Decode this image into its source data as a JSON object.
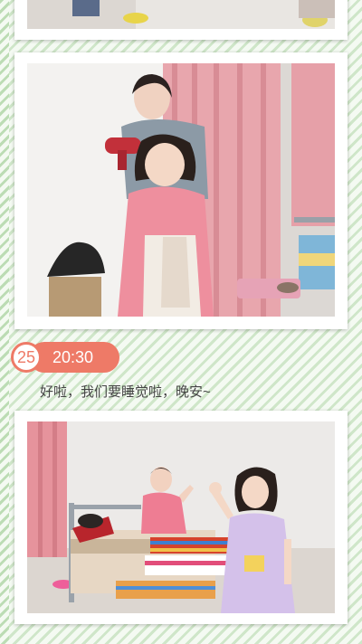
{
  "entry": {
    "day_number": "25",
    "time": "20:30",
    "caption": "好啦，我们要睡觉啦，晚安~"
  },
  "photos": [
    {
      "name": "photo-top-partial"
    },
    {
      "name": "photo-hair-drying"
    },
    {
      "name": "photo-bedroom-waving"
    }
  ],
  "colors": {
    "accent": "#ee7a67",
    "stripe_green": "#cfe6c9",
    "card_background": "#ffffff"
  }
}
